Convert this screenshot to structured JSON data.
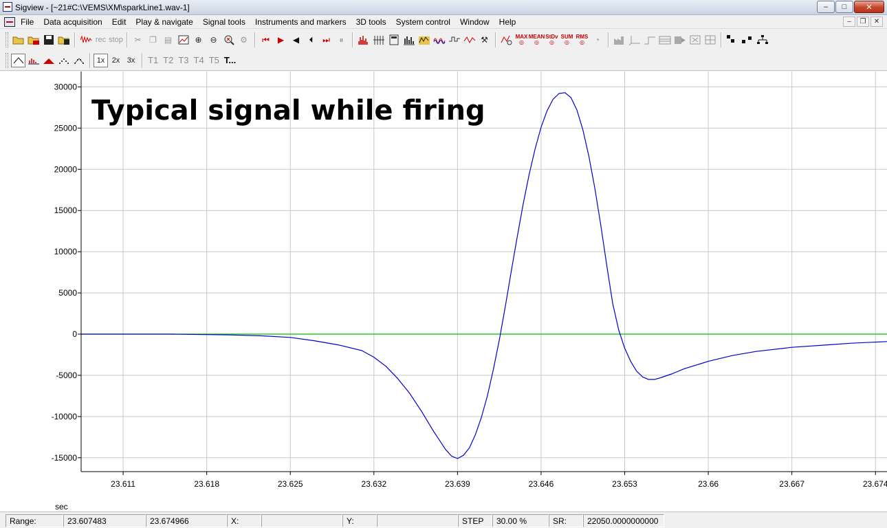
{
  "window": {
    "title": "Sigview - [~21#C:\\VEMS\\XM\\sparkLine1.wav-1]",
    "minimize_glyph": "–",
    "maximize_glyph": "□",
    "close_glyph": "✕"
  },
  "menu": [
    "File",
    "Data acquisition",
    "Edit",
    "Play & navigate",
    "Signal tools",
    "Instruments and markers",
    "3D tools",
    "System control",
    "Window",
    "Help"
  ],
  "mdi": {
    "minimize": "–",
    "restore": "❐",
    "close": "✕"
  },
  "toolbar1": {
    "rec_label": "rec",
    "stop_label": "stop",
    "stat_labels": [
      "MAX",
      "MEAN",
      "StDv",
      "SUM",
      "RMS"
    ]
  },
  "toolbar2": {
    "zoom_labels": [
      "1x",
      "2x",
      "3x"
    ],
    "trace_labels": [
      "T1",
      "T2",
      "T3",
      "T4",
      "T5",
      "T..."
    ]
  },
  "annotation": "Typical signal while firing",
  "chart_data": {
    "type": "line",
    "title": "",
    "xlabel": "sec",
    "ylabel": "",
    "xlim": [
      23.607483,
      23.674966
    ],
    "ylim": [
      -17000,
      31000
    ],
    "grid": true,
    "x_ticks": [
      "23.611",
      "23.618",
      "23.625",
      "23.632",
      "23.639",
      "23.646",
      "23.653",
      "23.66",
      "23.667",
      "23.674"
    ],
    "y_ticks": [
      "30000",
      "25000",
      "20000",
      "15000",
      "10000",
      "5000",
      "0",
      "-5000",
      "-10000",
      "-15000"
    ],
    "series": [
      {
        "color": "#0000cc",
        "x": [
          23.6075,
          23.61,
          23.615,
          23.62,
          23.6225,
          23.625,
          23.627,
          23.629,
          23.631,
          23.632,
          23.633,
          23.634,
          23.635,
          23.636,
          23.637,
          23.638,
          23.6385,
          23.639,
          23.6395,
          23.64,
          23.6405,
          23.641,
          23.6415,
          23.642,
          23.6425,
          23.643,
          23.6435,
          23.644,
          23.6445,
          23.645,
          23.6455,
          23.646,
          23.6465,
          23.647,
          23.6475,
          23.648,
          23.6485,
          23.649,
          23.6495,
          23.65,
          23.6505,
          23.651,
          23.6515,
          23.652,
          23.6525,
          23.653,
          23.6535,
          23.654,
          23.6545,
          23.655,
          23.6555,
          23.656,
          23.657,
          23.658,
          23.66,
          23.662,
          23.664,
          23.667,
          23.67,
          23.672,
          23.674966
        ],
        "y": [
          0,
          0,
          0,
          -100,
          -200,
          -400,
          -800,
          -1300,
          -2000,
          -2800,
          -3900,
          -5400,
          -7200,
          -9400,
          -11800,
          -14000,
          -14800,
          -15100,
          -14700,
          -13800,
          -12200,
          -10100,
          -7500,
          -4300,
          -700,
          3300,
          7600,
          11800,
          15800,
          19400,
          22500,
          25100,
          27100,
          28500,
          29200,
          29300,
          28700,
          27200,
          24800,
          21600,
          17700,
          13200,
          8300,
          3700,
          500,
          -1700,
          -3300,
          -4500,
          -5200,
          -5500,
          -5500,
          -5300,
          -4800,
          -4200,
          -3300,
          -2600,
          -2100,
          -1600,
          -1300,
          -1100,
          -900
        ]
      },
      {
        "color": "#00c000",
        "x": [
          23.607483,
          23.674966
        ],
        "y": [
          0,
          0
        ]
      }
    ]
  },
  "status": {
    "range_label": "Range:",
    "range_start": "23.607483",
    "range_end": "23.674966",
    "x_label": "X:",
    "x_value": "",
    "y_label": "Y:",
    "y_value": "",
    "step_label": "STEP",
    "step_value": "30.00 %",
    "sr_label": "SR:",
    "sr_value": "22050.0000000000"
  }
}
